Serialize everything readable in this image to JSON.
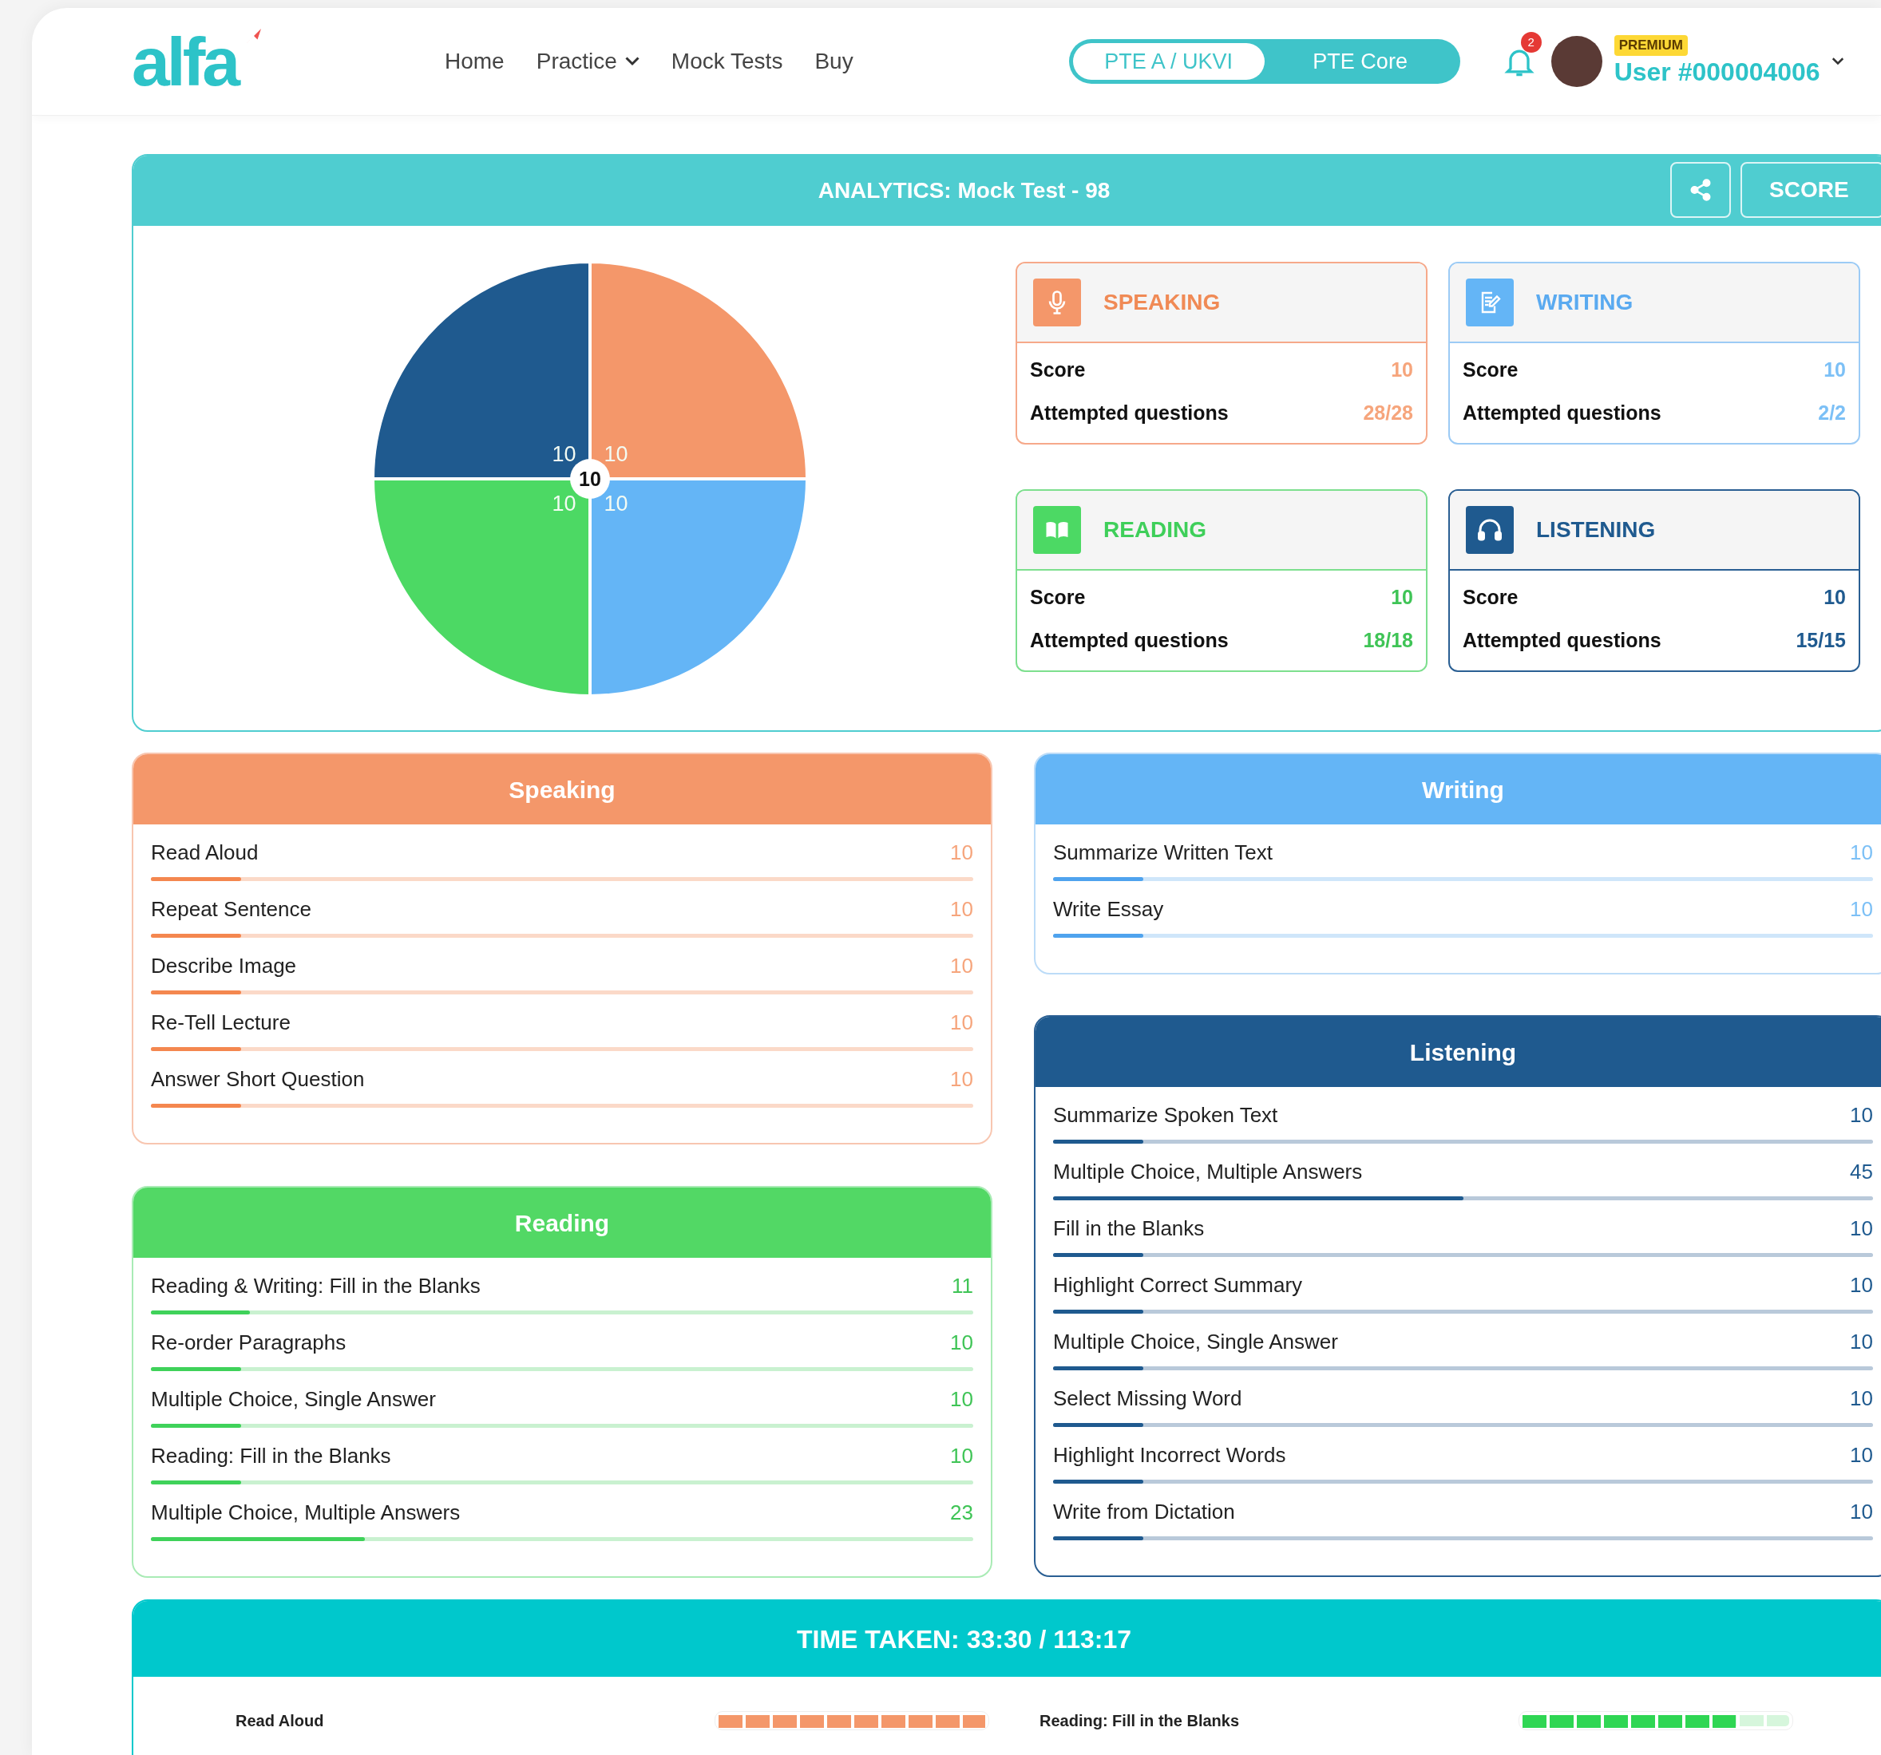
{
  "header": {
    "logo": "alfa",
    "nav": [
      {
        "label": "Home",
        "dropdown": false
      },
      {
        "label": "Practice",
        "dropdown": true
      },
      {
        "label": "Mock Tests",
        "dropdown": false
      },
      {
        "label": "Buy",
        "dropdown": false
      }
    ],
    "exam_toggle": [
      {
        "label": "PTE A / UKVI",
        "selected": true
      },
      {
        "label": "PTE Core",
        "selected": false
      }
    ],
    "notification_count": "2",
    "user": {
      "badge": "PREMIUM",
      "name": "User #000004006"
    }
  },
  "analytics": {
    "title": "ANALYTICS: Mock Test - 98",
    "score_button": "SCORE",
    "pie": {
      "center_label": "10",
      "chart_data": {
        "type": "pie",
        "values": [
          10,
          10,
          10,
          10
        ],
        "colors": [
          "#f4976a",
          "#64b5f6",
          "#4cd964",
          "#1f5a8f"
        ],
        "data_labels": true
      }
    },
    "cards": [
      {
        "kind": "speaking",
        "title": "SPEAKING",
        "rows": [
          {
            "label": "Score",
            "value": "10"
          },
          {
            "label": "Attempted questions",
            "value": "28/28"
          }
        ]
      },
      {
        "kind": "writing",
        "title": "WRITING",
        "rows": [
          {
            "label": "Score",
            "value": "10"
          },
          {
            "label": "Attempted questions",
            "value": "2/2"
          }
        ]
      },
      {
        "kind": "reading",
        "title": "READING",
        "rows": [
          {
            "label": "Score",
            "value": "10"
          },
          {
            "label": "Attempted questions",
            "value": "18/18"
          }
        ]
      },
      {
        "kind": "listening",
        "title": "LISTENING",
        "rows": [
          {
            "label": "Score",
            "value": "10"
          },
          {
            "label": "Attempted questions",
            "value": "15/15"
          }
        ]
      }
    ]
  },
  "left_sections": [
    {
      "kind": "speaking",
      "title": "Speaking",
      "items": [
        {
          "label": "Read Aloud",
          "score": "10",
          "level": 0.11
        },
        {
          "label": "Repeat Sentence",
          "score": "10",
          "level": 0.11
        },
        {
          "label": "Describe Image",
          "score": "10",
          "level": 0.11
        },
        {
          "label": "Re-Tell Lecture",
          "score": "10",
          "level": 0.11
        },
        {
          "label": "Answer Short Question",
          "score": "10",
          "level": 0.11
        }
      ]
    },
    {
      "kind": "reading",
      "title": "Reading",
      "items": [
        {
          "label": "Reading & Writing: Fill in the Blanks",
          "score": "11",
          "level": 0.12
        },
        {
          "label": "Re-order Paragraphs",
          "score": "10",
          "level": 0.11
        },
        {
          "label": "Multiple Choice, Single Answer",
          "score": "10",
          "level": 0.11
        },
        {
          "label": "Reading: Fill in the Blanks",
          "score": "10",
          "level": 0.11
        },
        {
          "label": "Multiple Choice, Multiple Answers",
          "score": "23",
          "level": 0.26
        }
      ]
    }
  ],
  "right_sections": [
    {
      "kind": "writing",
      "title": "Writing",
      "items": [
        {
          "label": "Summarize Written Text",
          "score": "10",
          "level": 0.11
        },
        {
          "label": "Write Essay",
          "score": "10",
          "level": 0.11
        }
      ]
    },
    {
      "kind": "listening",
      "title": "Listening",
      "items": [
        {
          "label": "Summarize Spoken Text",
          "score": "10",
          "level": 0.11
        },
        {
          "label": "Multiple Choice, Multiple Answers",
          "score": "45",
          "level": 0.5
        },
        {
          "label": "Fill in the Blanks",
          "score": "10",
          "level": 0.11
        },
        {
          "label": "Highlight Correct Summary",
          "score": "10",
          "level": 0.11
        },
        {
          "label": "Multiple Choice, Single Answer",
          "score": "10",
          "level": 0.11
        },
        {
          "label": "Select Missing Word",
          "score": "10",
          "level": 0.11
        },
        {
          "label": "Highlight Incorrect Words",
          "score": "10",
          "level": 0.11
        },
        {
          "label": "Write from Dictation",
          "score": "10",
          "level": 0.11
        }
      ]
    }
  ],
  "time_taken": {
    "title": "TIME TAKEN: 33:30 / 113:17",
    "rows": [
      {
        "kind": "speaking",
        "label": "Read Aloud",
        "level": 1
      },
      {
        "kind": "reading",
        "label": "Reading: Fill in the Blanks",
        "level": 0.8
      }
    ]
  }
}
